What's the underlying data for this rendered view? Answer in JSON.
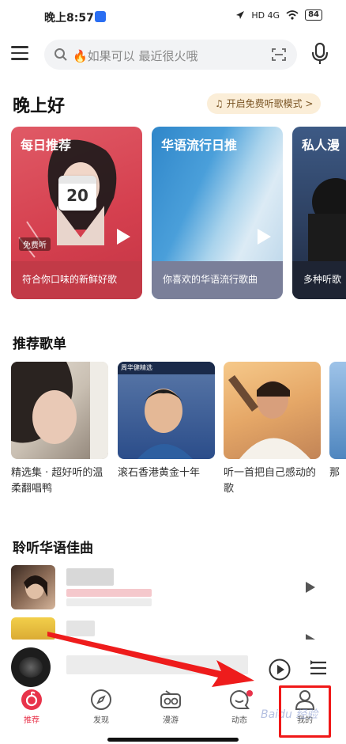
{
  "status_bar": {
    "time": "晚上8:57",
    "network": "HD 4G",
    "battery": "84"
  },
  "header": {
    "search_placeholder": "🔥如果可以 最近很火哦"
  },
  "greeting": {
    "title": "晚上好",
    "free_mode": "开启免费听歌模式 >"
  },
  "daily_cards": [
    {
      "title": "每日推荐",
      "caption": "符合你口味的新鲜好歌",
      "date": "20",
      "tag": "免费听"
    },
    {
      "title": "华语流行日推",
      "caption": "你喜欢的华语流行歌曲"
    },
    {
      "title": "私人漫",
      "caption": "多种听歌"
    }
  ],
  "playlists": {
    "title": "推荐歌单",
    "items": [
      {
        "name": "精选集 · 超好听的温柔翻唱鸭"
      },
      {
        "name": "滚石香港黄金十年",
        "cover_text": "周华健精选"
      },
      {
        "name": "听一首把自己感动的歌"
      },
      {
        "name": "那"
      }
    ]
  },
  "songs": {
    "title": "聆听华语佳曲"
  },
  "bottom_nav": {
    "items": [
      {
        "label": "推荐"
      },
      {
        "label": "发现"
      },
      {
        "label": "漫游"
      },
      {
        "label": "动态"
      },
      {
        "label": "我的"
      }
    ]
  },
  "watermark": "Baidu 经验",
  "colors": {
    "accent": "#e8334a",
    "highlight": "#f01818"
  }
}
